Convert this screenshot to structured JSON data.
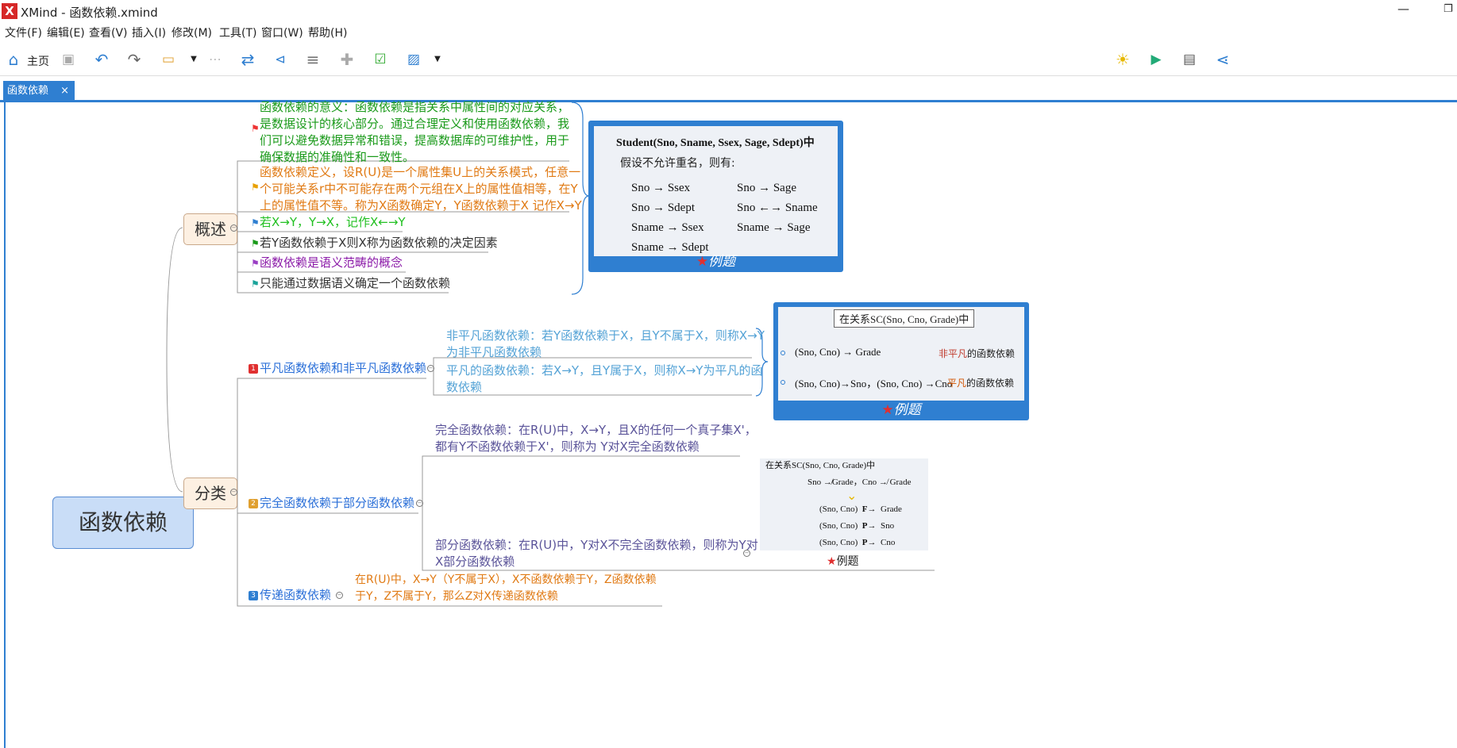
{
  "window": {
    "title": "XMind - 函数依赖.xmind",
    "logo": "X",
    "minimize": "—",
    "restore": "❐"
  },
  "menu": [
    "文件(F)",
    "编辑(E)",
    "查看(V)",
    "插入(I)",
    "修改(M)",
    "工具(T)",
    "窗口(W)",
    "帮助(H)"
  ],
  "toolbar": {
    "home_label": "主页"
  },
  "tab": {
    "label": "函数依赖",
    "close": "×"
  },
  "map": {
    "root": "函数依赖",
    "overview": {
      "label": "概述",
      "items": [
        "函数依赖的意义：函数依赖是指关系中属性间的对应关系，\n是数据设计的核心部分。通过合理定义和使用函数依赖，我\n们可以避免数据异常和错误，提高数据库的可维护性，用于\n确保数据的准确性和一致性。",
        "函数依赖定义，设R(U)是一个属性集U上的关系模式，任意一\n个可能关系r中不可能存在两个元组在X上的属性值相等，在Y\n上的属性值不等。称为X函数确定Y，Y函数依赖于X 记作X→Y",
        "若X→Y，Y→X，记作X←→Y",
        "若Y函数依赖于X则X称为函数依赖的决定因素",
        "函数依赖是语义范畴的概念",
        "只能通过数据语义确定一个函数依赖"
      ],
      "example": {
        "title": "Student(Sno, Sname, Ssex, Sage, Sdept)中",
        "sub": "假设不允许重名，则有:",
        "left": [
          "Sno → Ssex",
          "Sno → Sdept",
          "Sname → Ssex",
          "Sname → Sdept"
        ],
        "right": [
          "Sno → Sage",
          "Sno ←→ Sname",
          "Sname → Sage"
        ],
        "caption": "例题"
      }
    },
    "classify": {
      "label": "分类",
      "sub1": {
        "num": "1",
        "label": "平凡函数依赖和非平凡函数依赖",
        "items": [
          "非平凡函数依赖：若Y函数依赖于X，且Y不属于X，则称X→Y\n为非平凡函数依赖",
          "平凡的函数依赖：若X→Y，且Y属于X，则称X→Y为平凡的函\n数依赖"
        ],
        "example": {
          "title": "在关系SC(Sno, Cno, Grade)中",
          "row1_left": "(Sno, Cno) → Grade",
          "row1_right_hl": "非平凡",
          "row1_right": "的函数依赖",
          "row2_left": "(Sno, Cno)→Sno，(Sno, Cno) →Cno",
          "row2_right_hl": "平凡",
          "row2_right": "的函数依赖",
          "caption": "例题"
        }
      },
      "sub2": {
        "num": "2",
        "label": "完全函数依赖于部分函数依赖",
        "items": [
          "完全函数依赖：在R(U)中，X→Y，且X的任何一个真子集X'，\n都有Y不函数依赖于X'，则称为 Y对X完全函数依赖",
          "部分函数依赖：在R(U)中，Y对X不完全函数依赖，则称为Y对\nX部分函数依赖"
        ],
        "example": {
          "title": "在关系SC(Sno, Cno, Grade)中",
          "line2": "Sno ↛Grade，Cno ↛ Grade",
          "rows": [
            {
              "l": "(Sno, Cno)",
              "k": "F",
              "r": "Grade"
            },
            {
              "l": "(Sno, Cno)",
              "k": "P",
              "r": "Sno"
            },
            {
              "l": "(Sno, Cno)",
              "k": "P",
              "r": "Cno"
            }
          ],
          "caption": "例题"
        }
      },
      "sub3": {
        "num": "3",
        "label": "传递函数依赖",
        "text": "在R(U)中，X→Y（Y不属于X），X不函数依赖于Y，Z函数依赖\n于Y，Z不属于Y，那么Z对X传递函数依赖"
      }
    }
  }
}
